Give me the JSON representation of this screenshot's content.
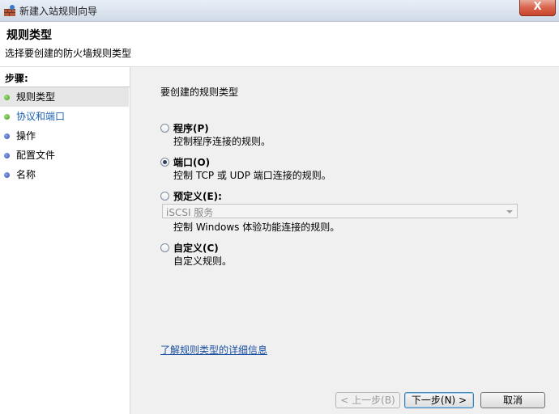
{
  "window": {
    "title": "新建入站规则向导",
    "close_glyph": "X"
  },
  "header": {
    "title": "规则类型",
    "subtitle": "选择要创建的防火墙规则类型"
  },
  "steps": {
    "heading": "步骤:",
    "items": [
      {
        "label": "规则类型",
        "dot": "green"
      },
      {
        "label": "协议和端口",
        "dot": "green"
      },
      {
        "label": "操作",
        "dot": "blue"
      },
      {
        "label": "配置文件",
        "dot": "blue"
      },
      {
        "label": "名称",
        "dot": "blue"
      }
    ]
  },
  "content": {
    "question": "要创建的规则类型",
    "options": [
      {
        "title": "程序(P)",
        "desc": "控制程序连接的规则。",
        "checked": false
      },
      {
        "title": "端口(O)",
        "desc": "控制 TCP 或 UDP 端口连接的规则。",
        "checked": true
      },
      {
        "title": "预定义(E):",
        "desc": "控制 Windows 体验功能连接的规则。",
        "checked": false
      },
      {
        "title": "自定义(C)",
        "desc": "自定义规则。",
        "checked": false
      }
    ],
    "predefined_select": {
      "value": "iSCSI 服务"
    },
    "learn_more": "了解规则类型的详细信息"
  },
  "buttons": {
    "back": "< 上一步(B)",
    "next": "下一步(N) >",
    "cancel": "取消"
  }
}
